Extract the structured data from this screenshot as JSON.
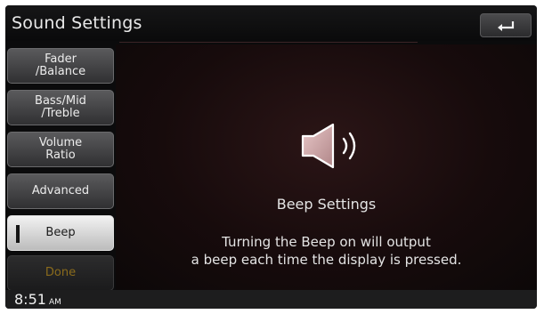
{
  "header": {
    "title": "Sound Settings",
    "back_icon": "return-arrow-icon"
  },
  "sidebar": {
    "items": [
      {
        "label": "Fader\n/Balance",
        "state": "normal"
      },
      {
        "label": "Bass/Mid\n/Treble",
        "state": "normal"
      },
      {
        "label": "Volume\nRatio",
        "state": "normal"
      },
      {
        "label": "Advanced",
        "state": "normal"
      },
      {
        "label": "Beep",
        "state": "selected"
      },
      {
        "label": "Done",
        "state": "disabled"
      }
    ]
  },
  "main": {
    "icon": "speaker-icon",
    "heading": "Beep Settings",
    "description_line1": "Turning the Beep on will output",
    "description_line2": "a beep each time the display is pressed."
  },
  "footer": {
    "time": "8:51",
    "ampm": "AM"
  },
  "colors": {
    "background": "#0b0b0c",
    "panel": "#2b1516",
    "selected": "#e6e6e6",
    "done_text": "#8a6b1c"
  }
}
